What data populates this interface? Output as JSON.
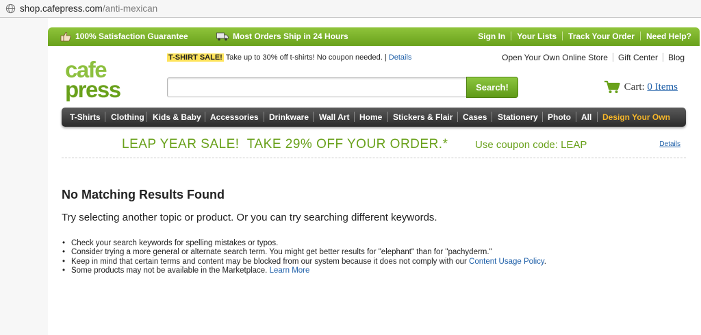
{
  "browser": {
    "url_host": "shop.cafepress.com",
    "url_path": "/anti-mexican"
  },
  "topbar": {
    "promo_guarantee": "100% Satisfaction Guarantee",
    "promo_shipping": "Most Orders Ship in 24 Hours",
    "links": [
      "Sign In",
      "Your Lists",
      "Track Your Order",
      "Need Help?"
    ]
  },
  "logo": {
    "line1": "cafe",
    "line2": "press"
  },
  "sale": {
    "tag": "T-SHIRT SALE!",
    "text": "Take up to 30% off t-shirts! No coupon needed. |",
    "details": "Details"
  },
  "store_links": [
    "Open Your Own Online Store",
    "Gift Center",
    "Blog"
  ],
  "search": {
    "placeholder": "",
    "button": "Search!"
  },
  "cart": {
    "label": "Cart:",
    "count": "0 Items"
  },
  "nav": {
    "items": [
      "T-Shirts",
      "Clothing",
      "Kids & Baby",
      "Accessories",
      "Drinkware",
      "Wall Art",
      "Home",
      "Stickers & Flair",
      "Cases",
      "Stationery",
      "Photo",
      "All"
    ],
    "design": "Design Your Own"
  },
  "leap": {
    "headline": "LEAP YEAR SALE!  TAKE 29% OFF YOUR ORDER.*",
    "code": "Use coupon code: LEAP",
    "details": "Details"
  },
  "results": {
    "heading": "No Matching Results Found",
    "subheading": "Try selecting another topic or product. Or you can try searching different keywords.",
    "tips": [
      "Check your search keywords for spelling mistakes or typos.",
      "Consider trying a more general or alternate search term. You might get better results for \"elephant\" than for \"pachyderm.\"",
      "Keep in mind that certain terms and content may be blocked from our system because it does not comply with our",
      "Some products may not be available in the Marketplace."
    ],
    "policy_link": "Content Usage Policy",
    "policy_end": ".",
    "learn_more": "Learn More"
  },
  "colors": {
    "brand_green": "#69a11b",
    "link_blue": "#1e5fa8",
    "nav_dark": "#2b2b2b",
    "design_orange": "#f7b72a"
  }
}
